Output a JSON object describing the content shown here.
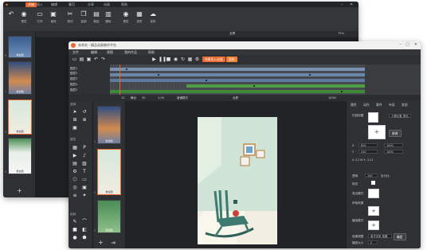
{
  "back_window": {
    "tabs": [
      "开始",
      "插入",
      "编辑",
      "幕页",
      "分享",
      "动画",
      "帮助"
    ],
    "active_tab": 0,
    "ribbon": [
      {
        "icon": "eye-icon",
        "label": "预览"
      },
      {
        "icon": "folder-icon",
        "label": "打开"
      },
      {
        "icon": "save-icon",
        "label": "保存"
      },
      {
        "icon": "cut-icon",
        "label": "剪切"
      },
      {
        "icon": "copy-icon",
        "label": "复制"
      },
      {
        "icon": "paste-icon",
        "label": "粘贴"
      },
      {
        "icon": "delete-icon",
        "label": "删除"
      },
      {
        "icon": "eye-icon",
        "label": "预览"
      },
      {
        "icon": "grid-icon",
        "label": "发布"
      },
      {
        "icon": "cloud-icon",
        "label": "发布"
      }
    ],
    "subbar": {
      "left_value": "全屏",
      "mid_value": "全屏",
      "zoom": "75%"
    },
    "slides": [
      {
        "num": "6",
        "label": "舞台图"
      },
      {
        "num": "7",
        "label": "舞台图"
      },
      {
        "num": "8",
        "label": "舞台图"
      },
      {
        "num": "9",
        "label": "舞台图"
      }
    ]
  },
  "front_window": {
    "title": "未命名 - 精品动画制作平台",
    "menus": [
      "文件",
      "编辑",
      "视图",
      "我的作品",
      "帮助"
    ],
    "orange_buttons": [
      "场景导入动画",
      "发布"
    ],
    "layers": [
      "图层1",
      "图层2",
      "图层3",
      "图层4",
      "图层5"
    ],
    "timeline_footer": {
      "frame": "12",
      "fps": "30",
      "time": "1.00",
      "mode": "普通模式"
    },
    "stage_bar": {
      "label": "舞台",
      "value": "全屏",
      "zoom": "100%"
    },
    "tool_sections": [
      "选择",
      "属性",
      "绘制"
    ],
    "slides": [
      {
        "num": "1",
        "label": "舞台图"
      },
      {
        "num": "2",
        "label": "舞台图"
      },
      {
        "num": "3",
        "label": "舞台图"
      }
    ],
    "props": {
      "tabs": [
        "属性",
        "动作",
        "事件",
        "布局",
        "其他"
      ],
      "content_label": "内容标题",
      "name_field": "人物元素_默认",
      "name_button": "修改",
      "x": "620",
      "y": "410",
      "w": "1000",
      "h": "1000",
      "coord_label": "X: 4.276  Y: -3.21",
      "opacity_label": "透明",
      "opacity_value": "100",
      "opacity_unit": "百分比",
      "fill_label": "填充",
      "blend_label": "混合模式",
      "sound_label": "声音效果",
      "action_label": "播放模式",
      "effect_label": "效果调整",
      "effect_value": "电子手机 效果",
      "effect_button": "确定",
      "speed_label": "播放大小",
      "speed_value": "0"
    }
  },
  "colors": {
    "accent": "#e8682e",
    "dark_bg": "#2b2d30",
    "track_blue": "#6f8fb3",
    "track_green": "#4e9d45",
    "wall": "#cfe3d6",
    "floor": "#f3eee4",
    "chair": "#3f7a70"
  }
}
